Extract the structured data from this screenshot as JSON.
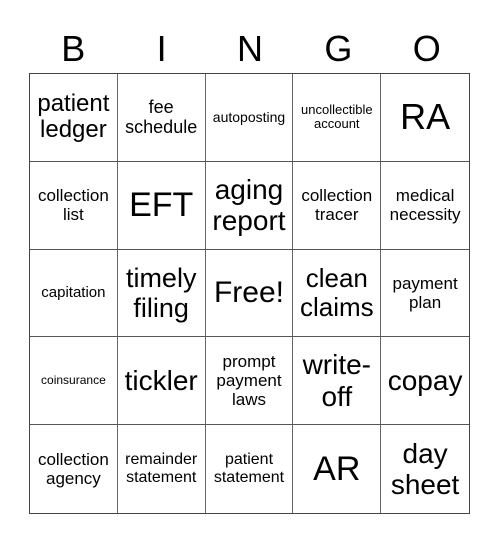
{
  "header": [
    "B",
    "I",
    "N",
    "G",
    "O"
  ],
  "cells": [
    {
      "text": "patient ledger",
      "size": 24
    },
    {
      "text": "fee schedule",
      "size": 18
    },
    {
      "text": "autoposting",
      "size": 14
    },
    {
      "text": "uncollectible account",
      "size": 13
    },
    {
      "text": "RA",
      "size": 36
    },
    {
      "text": "collection list",
      "size": 17
    },
    {
      "text": "EFT",
      "size": 34
    },
    {
      "text": "aging report",
      "size": 28
    },
    {
      "text": "collection tracer",
      "size": 17
    },
    {
      "text": "medical necessity",
      "size": 17
    },
    {
      "text": "capitation",
      "size": 15
    },
    {
      "text": "timely filing",
      "size": 27
    },
    {
      "text": "Free!",
      "size": 30
    },
    {
      "text": "clean claims",
      "size": 26
    },
    {
      "text": "payment plan",
      "size": 17
    },
    {
      "text": "coinsurance",
      "size": 12
    },
    {
      "text": "tickler",
      "size": 28
    },
    {
      "text": "prompt payment laws",
      "size": 17
    },
    {
      "text": "write-off",
      "size": 28
    },
    {
      "text": "copay",
      "size": 28
    },
    {
      "text": "collection agency",
      "size": 17
    },
    {
      "text": "remainder statement",
      "size": 16
    },
    {
      "text": "patient statement",
      "size": 16
    },
    {
      "text": "AR",
      "size": 34
    },
    {
      "text": "day sheet",
      "size": 28
    }
  ]
}
